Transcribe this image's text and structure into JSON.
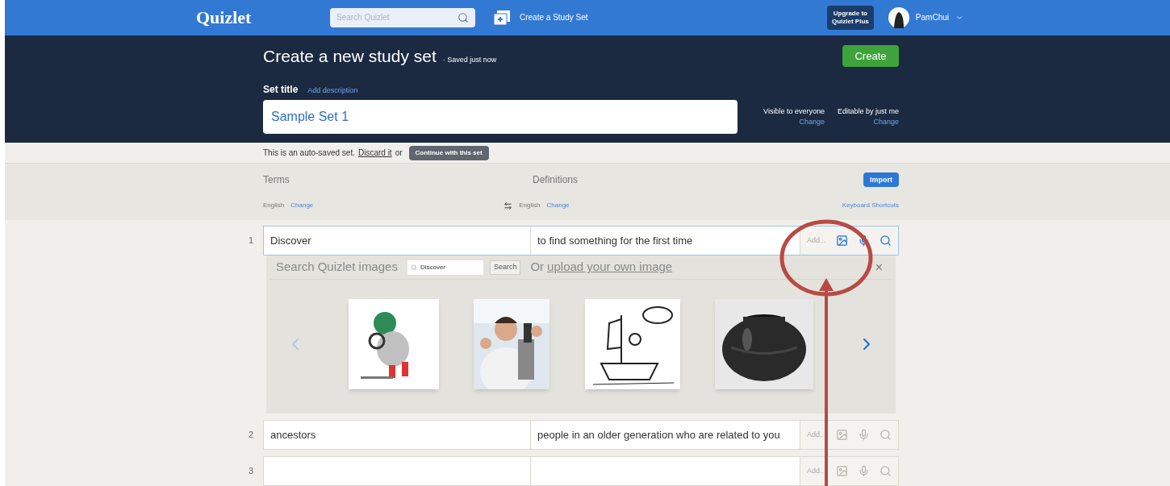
{
  "nav": {
    "logo": "Quizlet",
    "search_placeholder": "Search Quizlet",
    "create_link": "Create a Study Set",
    "upgrade": "Upgrade to Quizlet Plus",
    "user": "PamChui"
  },
  "header": {
    "title": "Create a new study set",
    "saved": "· Saved just now",
    "create_button": "Create",
    "set_title_label": "Set title",
    "add_description": "Add description",
    "title_value": "Sample Set 1",
    "visibility": [
      {
        "label": "Visible to everyone",
        "change": "Change"
      },
      {
        "label": "Editable by just me",
        "change": "Change"
      }
    ]
  },
  "autosave": {
    "text": "This is an auto-saved set.",
    "discard": "Discard it",
    "or": "or",
    "continue": "Continue with this set"
  },
  "columns": {
    "terms": "Terms",
    "definitions": "Definitions",
    "import": "Import",
    "term_language": "English",
    "term_change": "Change",
    "def_language": "English",
    "def_change": "Change",
    "shortcuts": "Keyboard Shortcuts"
  },
  "image_search": {
    "label": "Search Quizlet images",
    "query": "Discover",
    "search_button": "Search",
    "upload_prefix": "Or",
    "upload_link": "upload your own image",
    "close": "×"
  },
  "rows": [
    {
      "number": "1",
      "term": "Discover",
      "definition": "to find something for the first time",
      "add": "Add...",
      "active": true
    },
    {
      "number": "2",
      "term": "ancestors",
      "definition": "people in an older generation who are related to you",
      "add": "Add...",
      "active": false
    },
    {
      "number": "3",
      "add": "Add...",
      "active": false
    }
  ]
}
